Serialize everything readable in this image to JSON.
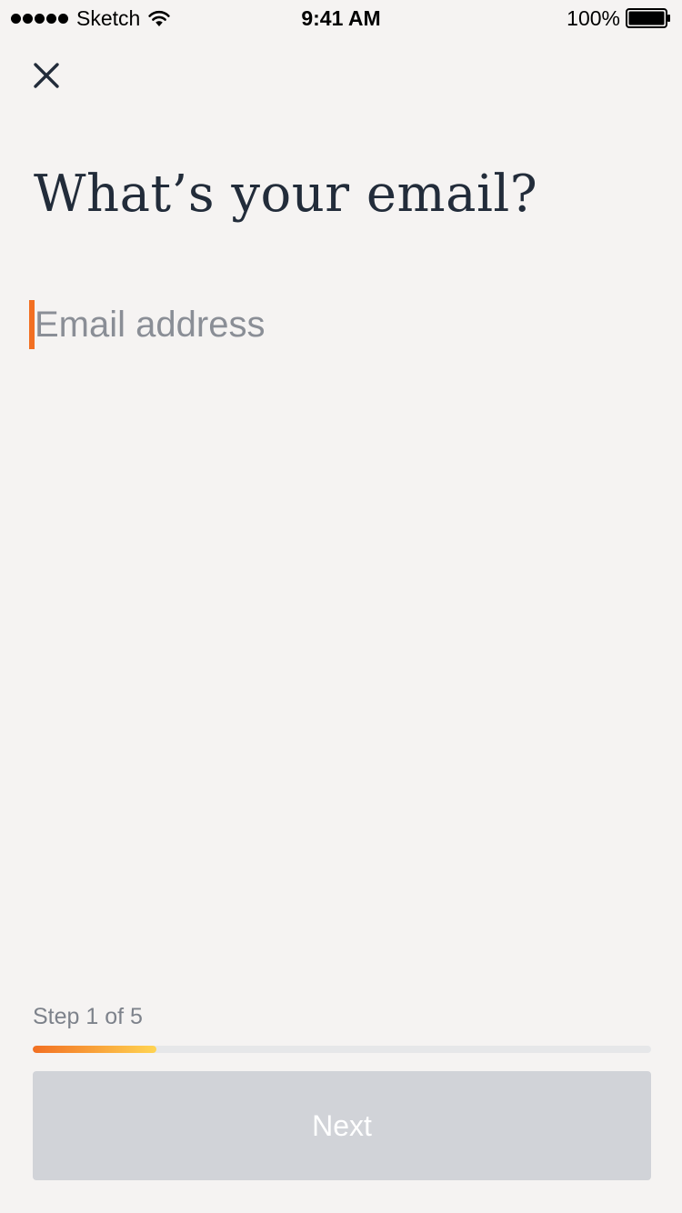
{
  "status_bar": {
    "carrier": "Sketch",
    "time": "9:41 AM",
    "battery": "100%",
    "icons": [
      "signal-dots-icon",
      "wifi-icon",
      "battery-icon"
    ]
  },
  "header": {
    "close_icon": "close-icon"
  },
  "main": {
    "title": "What’s your email?",
    "email_placeholder": "Email address",
    "email_value": ""
  },
  "footer": {
    "step_label": "Step 1 of 5",
    "progress_fraction": 0.2,
    "next_label": "Next"
  },
  "colors": {
    "background": "#f5f3f2",
    "title": "#222c3a",
    "accent_start": "#f26f22",
    "accent_end": "#ffd452",
    "progress_track": "#e6e7e9",
    "button_disabled": "#d1d3d8",
    "placeholder": "#8a8e96"
  }
}
